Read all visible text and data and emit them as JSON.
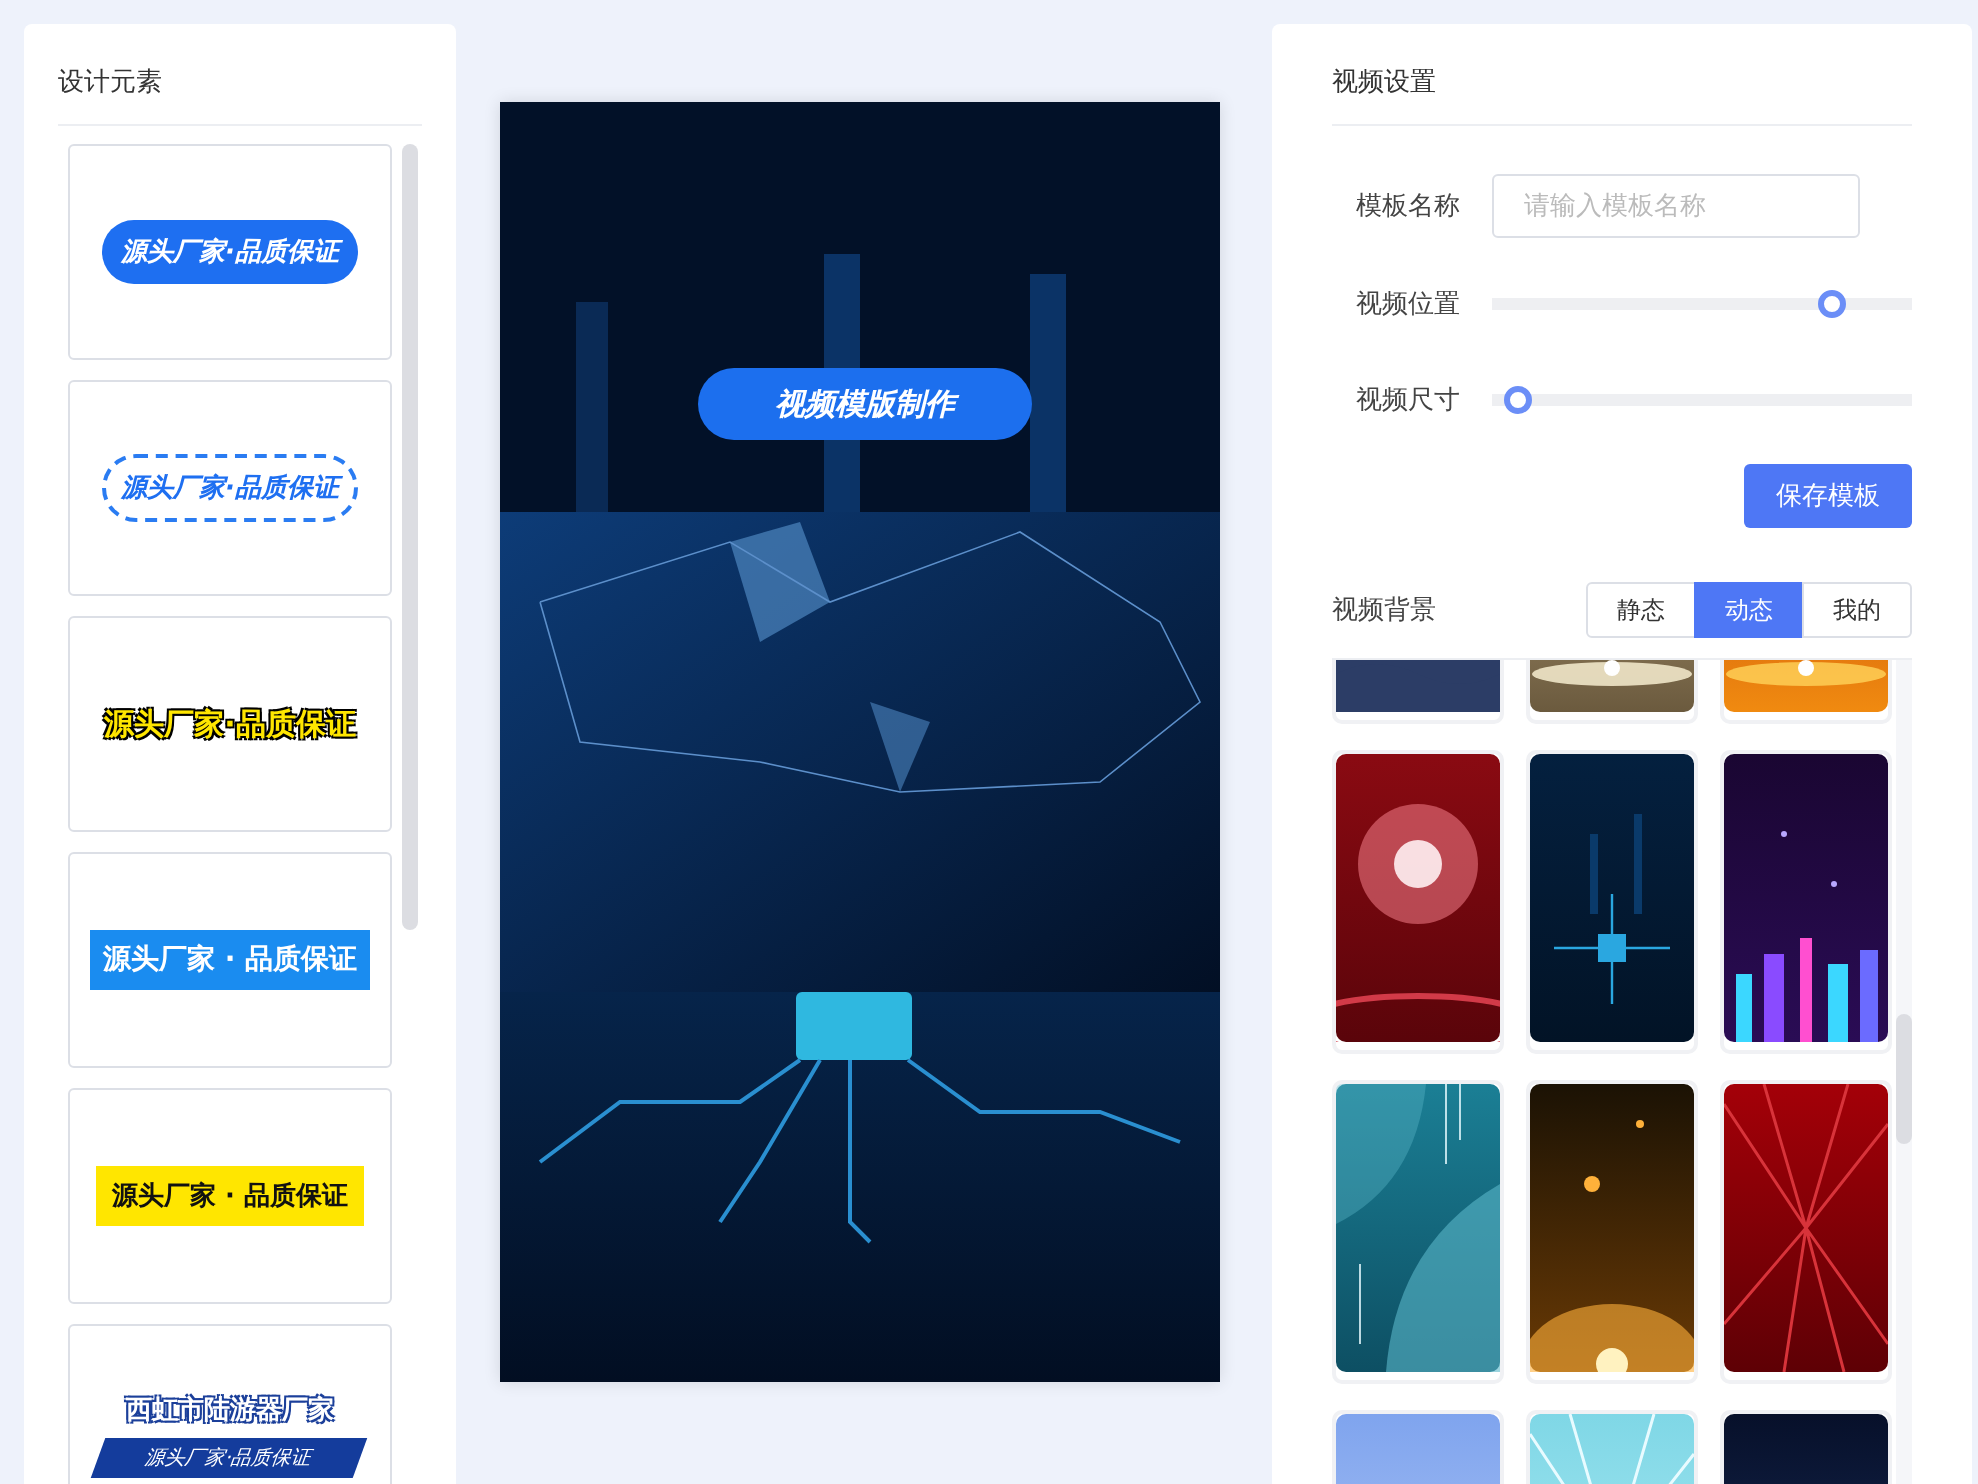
{
  "design_panel": {
    "title": "设计元素",
    "elements": [
      {
        "kind": "pill",
        "text": "源头厂家·品质保证"
      },
      {
        "kind": "dashed",
        "text": "源头厂家·品质保证"
      },
      {
        "kind": "outlined",
        "text": "源头厂家·品质保证"
      },
      {
        "kind": "blue-bar",
        "text": "源头厂家 · 品质保证"
      },
      {
        "kind": "yellow-bar",
        "text": "源头厂家 · 品质保证"
      },
      {
        "kind": "banner",
        "text": "西虹市陆游器厂家",
        "subtext": "源头厂家·品质保证"
      }
    ]
  },
  "preview": {
    "caption": "视频模版制作"
  },
  "settings": {
    "title": "视频设置",
    "name_field": {
      "label": "模板名称",
      "placeholder": "请输入模板名称"
    },
    "sliders": [
      {
        "label": "视频位置",
        "level": 0.83
      },
      {
        "label": "视频尺寸",
        "level": 0.03
      }
    ],
    "save_button": "保存模板"
  },
  "backgrounds": {
    "title": "视频背景",
    "tabs": [
      {
        "label": "静态",
        "selected": false
      },
      {
        "label": "动态",
        "selected": true
      },
      {
        "label": "我的",
        "selected": false
      }
    ]
  }
}
